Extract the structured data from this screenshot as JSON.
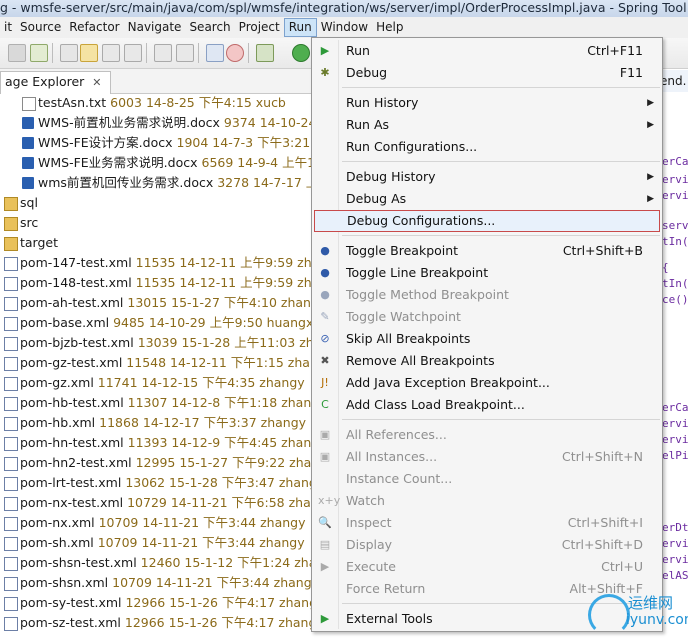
{
  "window": {
    "title": "g - wmsfe-server/src/main/java/com/spl/wmsfe/integration/ws/server/impl/OrderProcessImpl.java - Spring Tool Suite"
  },
  "menubar": {
    "items": [
      {
        "label": "it"
      },
      {
        "label": "Source"
      },
      {
        "label": "Refactor"
      },
      {
        "label": "Navigate"
      },
      {
        "label": "Search"
      },
      {
        "label": "Project"
      },
      {
        "label": "Run",
        "active": true
      },
      {
        "label": "Window"
      },
      {
        "label": "Help"
      }
    ]
  },
  "explorer": {
    "tab_label": "age Explorer",
    "close_glyph": "✕",
    "rows": [
      {
        "icon": "file",
        "name": "testAsn.txt",
        "meta": "6003  14-8-25 下午4:15  xucb"
      },
      {
        "icon": "doc",
        "name": "WMS-前置机业务需求说明.docx",
        "meta": "9374  14-10-24 上"
      },
      {
        "icon": "doc",
        "name": "WMS-FE设计方案.docx",
        "meta": "1904  14-7-3 下午3:21  h"
      },
      {
        "icon": "doc",
        "name": "WMS-FE业务需求说明.docx",
        "meta": "6569  14-9-4 上午11"
      },
      {
        "icon": "doc",
        "name": "wms前置机回传业务需求.docx",
        "meta": "3278  14-7-17 上午"
      },
      {
        "icon": "folder",
        "name": "sql",
        "meta": ""
      },
      {
        "icon": "folder",
        "name": "src",
        "meta": ""
      },
      {
        "icon": "folder",
        "name": "target",
        "meta": ""
      },
      {
        "icon": "pom",
        "name": "pom-147-test.xml",
        "meta": "11535  14-12-11 上午9:59  zhang"
      },
      {
        "icon": "pom",
        "name": "pom-148-test.xml",
        "meta": "11535  14-12-11 上午9:59  zhang"
      },
      {
        "icon": "pom",
        "name": "pom-ah-test.xml",
        "meta": "13015  15-1-27 下午4:10  zhangy"
      },
      {
        "icon": "pom",
        "name": "pom-base.xml",
        "meta": "9485  14-10-29 上午9:50  huangx"
      },
      {
        "icon": "pom",
        "name": "pom-bjzb-test.xml",
        "meta": "13039  15-1-28 上午11:03  zhan"
      },
      {
        "icon": "pom",
        "name": "pom-gz-test.xml",
        "meta": "11548  14-12-11 下午1:15  zhangy"
      },
      {
        "icon": "pom",
        "name": "pom-gz.xml",
        "meta": "11741  14-12-15 下午4:35  zhangy"
      },
      {
        "icon": "pom",
        "name": "pom-hb-test.xml",
        "meta": "11307  14-12-8 下午1:18  zhangy"
      },
      {
        "icon": "pom",
        "name": "pom-hb.xml",
        "meta": "11868  14-12-17 下午3:37  zhangy"
      },
      {
        "icon": "pom",
        "name": "pom-hn-test.xml",
        "meta": "11393  14-12-9 下午4:45  zhangy"
      },
      {
        "icon": "pom",
        "name": "pom-hn2-test.xml",
        "meta": "12995  15-1-27 下午9:22  zhangy"
      },
      {
        "icon": "pom",
        "name": "pom-lrt-test.xml",
        "meta": "13062  15-1-28 下午3:47  zhangy"
      },
      {
        "icon": "pom",
        "name": "pom-nx-test.xml",
        "meta": "10729  14-11-21 下午6:58  zhangy"
      },
      {
        "icon": "pom",
        "name": "pom-nx.xml",
        "meta": "10709  14-11-21 下午3:44  zhangy"
      },
      {
        "icon": "pom",
        "name": "pom-sh.xml",
        "meta": "10709  14-11-21 下午3:44  zhangy"
      },
      {
        "icon": "pom",
        "name": "pom-shsn-test.xml",
        "meta": "12460  15-1-12 下午1:24  zhang"
      },
      {
        "icon": "pom",
        "name": "pom-shsn.xml",
        "meta": "10709  14-11-21 下午3:44  zhangy"
      },
      {
        "icon": "pom",
        "name": "pom-sy-test.xml",
        "meta": "12966  15-1-26 下午4:17  zhangy"
      },
      {
        "icon": "pom",
        "name": "pom-sz-test.xml",
        "meta": "12966  15-1-26 下午4:17  zhang"
      }
    ]
  },
  "editor": {
    "tab_label": "end.",
    "fragments": [
      "erCa",
      "ervi",
      "ervi",
      "serv",
      "tIn(",
      "{",
      "tIn(",
      "ce()",
      "erCa",
      "ervi",
      "ervi",
      "elPi",
      "erDt",
      "ervi",
      "ervi",
      "elAS"
    ]
  },
  "run_menu": {
    "items": [
      {
        "label": "Run",
        "shortcut": "Ctrl+F11",
        "icon": "run-icon",
        "glyph": "▶",
        "color": "#2e9a3a"
      },
      {
        "label": "Debug",
        "shortcut": "F11",
        "icon": "debug-icon",
        "glyph": "✱",
        "color": "#6a7b2a"
      },
      {
        "sep": true
      },
      {
        "label": "Run History",
        "submenu": true
      },
      {
        "label": "Run As",
        "submenu": true
      },
      {
        "label": "Run Configurations...",
        "icon": "none"
      },
      {
        "sep": true
      },
      {
        "label": "Debug History",
        "submenu": true
      },
      {
        "label": "Debug As",
        "submenu": true
      },
      {
        "label": "Debug Configurations...",
        "highlighted": true
      },
      {
        "sep": true
      },
      {
        "label": "Toggle Breakpoint",
        "shortcut": "Ctrl+Shift+B",
        "icon": "breakpoint-icon",
        "glyph": "●",
        "color": "#2f5aa8"
      },
      {
        "label": "Toggle Line Breakpoint",
        "icon": "line-breakpoint-icon",
        "glyph": "●",
        "color": "#2f5aa8"
      },
      {
        "label": "Toggle Method Breakpoint",
        "disabled": true,
        "icon": "method-breakpoint-icon",
        "glyph": "●",
        "color": "#9aa6bc"
      },
      {
        "label": "Toggle Watchpoint",
        "disabled": true,
        "icon": "watchpoint-icon",
        "glyph": "✎",
        "color": "#9aa6bc"
      },
      {
        "label": "Skip All Breakpoints",
        "icon": "skip-breakpoints-icon",
        "glyph": "⊘",
        "color": "#3a62b3"
      },
      {
        "label": "Remove All Breakpoints",
        "icon": "remove-breakpoints-icon",
        "glyph": "✖",
        "color": "#555555"
      },
      {
        "label": "Add Java Exception Breakpoint...",
        "icon": "exception-breakpoint-icon",
        "glyph": "J!",
        "color": "#b36b00"
      },
      {
        "label": "Add Class Load Breakpoint...",
        "icon": "class-load-icon",
        "glyph": "C",
        "color": "#2e9a3a"
      },
      {
        "sep": true
      },
      {
        "label": "All References...",
        "disabled": true,
        "icon": "references-icon",
        "glyph": "▣",
        "color": "#aaaaaa"
      },
      {
        "label": "All Instances...",
        "shortcut": "Ctrl+Shift+N",
        "disabled": true,
        "icon": "instances-icon",
        "glyph": "▣",
        "color": "#aaaaaa"
      },
      {
        "label": "Instance Count...",
        "disabled": true
      },
      {
        "label": "Watch",
        "disabled": true,
        "icon": "watch-icon",
        "glyph": "x+y",
        "color": "#aaaaaa"
      },
      {
        "label": "Inspect",
        "shortcut": "Ctrl+Shift+I",
        "disabled": true,
        "icon": "inspect-icon",
        "glyph": "🔍",
        "color": "#aaaaaa"
      },
      {
        "label": "Display",
        "shortcut": "Ctrl+Shift+D",
        "disabled": true,
        "icon": "display-icon",
        "glyph": "▤",
        "color": "#aaaaaa"
      },
      {
        "label": "Execute",
        "shortcut": "Ctrl+U",
        "disabled": true,
        "icon": "execute-icon",
        "glyph": "▶",
        "color": "#aaaaaa"
      },
      {
        "label": "Force Return",
        "shortcut": "Alt+Shift+F",
        "disabled": true
      },
      {
        "sep": true
      },
      {
        "label": "External Tools",
        "submenu": true,
        "icon": "external-tools-icon",
        "glyph": "▶",
        "color": "#2e9a3a"
      }
    ]
  },
  "watermark": {
    "cn": "运维网",
    "en": "iyunv.com"
  }
}
